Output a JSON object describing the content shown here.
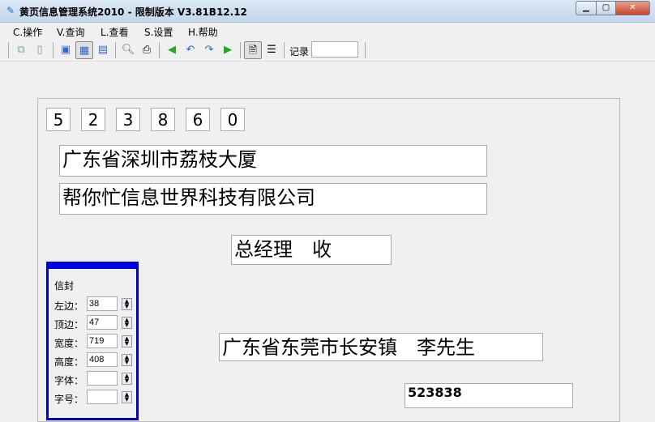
{
  "window": {
    "title": "黄页信息管理系统2010 - 限制版本 V3.81B12.12"
  },
  "menu": [
    "C.操作",
    "V.查询",
    "L.查看",
    "S.设置",
    "H.帮助"
  ],
  "toolbar": {
    "record_label": "记录",
    "record_value": ""
  },
  "envelope": {
    "postcode_digits": [
      "5",
      "2",
      "3",
      "8",
      "6",
      "0"
    ],
    "address": "广东省深圳市荔枝大厦",
    "company": "帮你忙信息世界科技有限公司",
    "recipient": "总经理　收",
    "sender_address": "广东省东莞市长安镇　李先生",
    "sender_postcode": "523838"
  },
  "props": {
    "title": "信封",
    "fields": [
      {
        "label": "左边：",
        "value": "38"
      },
      {
        "label": "顶边：",
        "value": "47"
      },
      {
        "label": "宽度：",
        "value": "719"
      },
      {
        "label": "高度：",
        "value": "408"
      },
      {
        "label": "字体：",
        "value": ""
      },
      {
        "label": "字号：",
        "value": ""
      }
    ]
  }
}
